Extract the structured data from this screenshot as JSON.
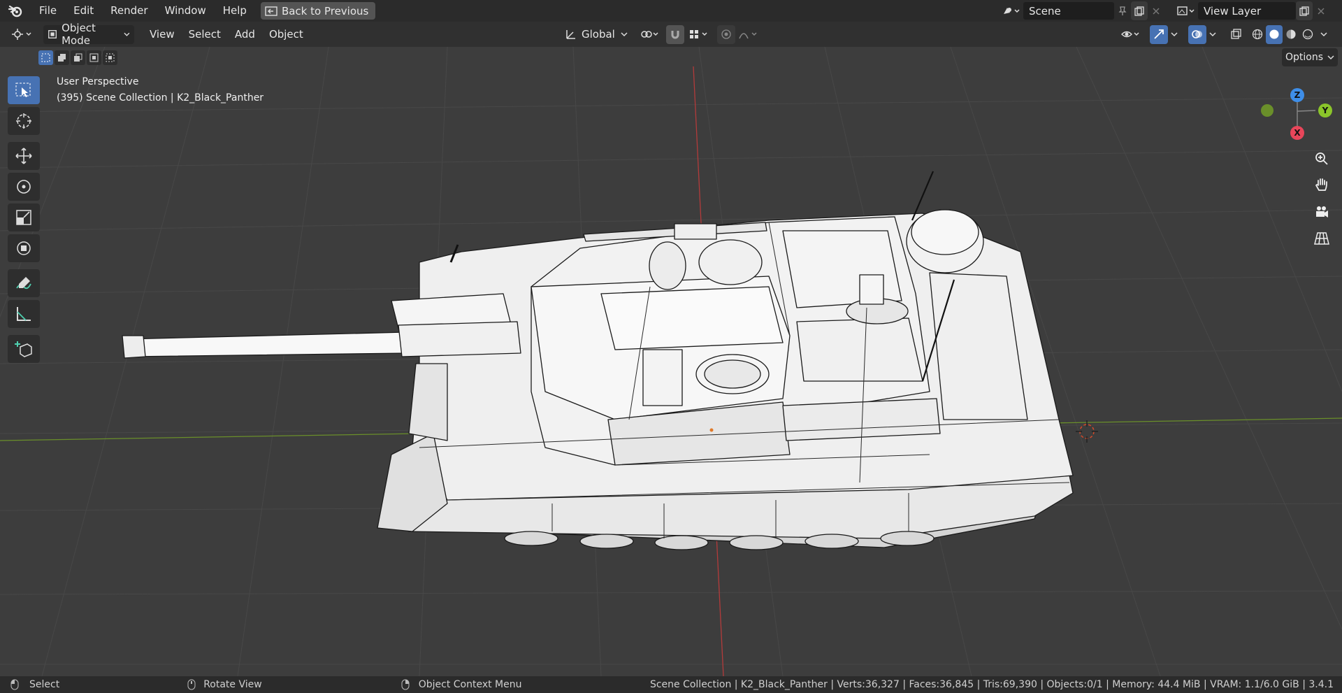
{
  "menubar": {
    "items": [
      "File",
      "Edit",
      "Render",
      "Window",
      "Help"
    ],
    "back_button": "Back to Previous",
    "scene_name": "Scene",
    "view_layer": "View Layer"
  },
  "header": {
    "mode": "Object Mode",
    "menus": [
      "View",
      "Select",
      "Add",
      "Object"
    ],
    "transform_orientation": "Global"
  },
  "viewport": {
    "perspective_label": "User Perspective",
    "collection_label": "(395) Scene Collection | K2_Black_Panther",
    "options_label": "Options",
    "gizmo": {
      "x": "X",
      "y": "Y",
      "z": "Z"
    }
  },
  "statusbar": {
    "left_hint": "Select",
    "middle_hint": "Rotate View",
    "right_hint": "Object Context Menu",
    "stats": "Scene Collection | K2_Black_Panther | Verts:36,327 | Faces:36,845 | Tris:69,390 | Objects:0/1 | Memory: 44.4 MiB | VRAM: 1.1/6.0 GiB | 3.4.1"
  },
  "colors": {
    "accent": "#4772b3",
    "axis_x": "#e8465a",
    "axis_y": "#8bc52a",
    "axis_z": "#3e8ee8",
    "viewport_bg": "#3d3d3d"
  }
}
